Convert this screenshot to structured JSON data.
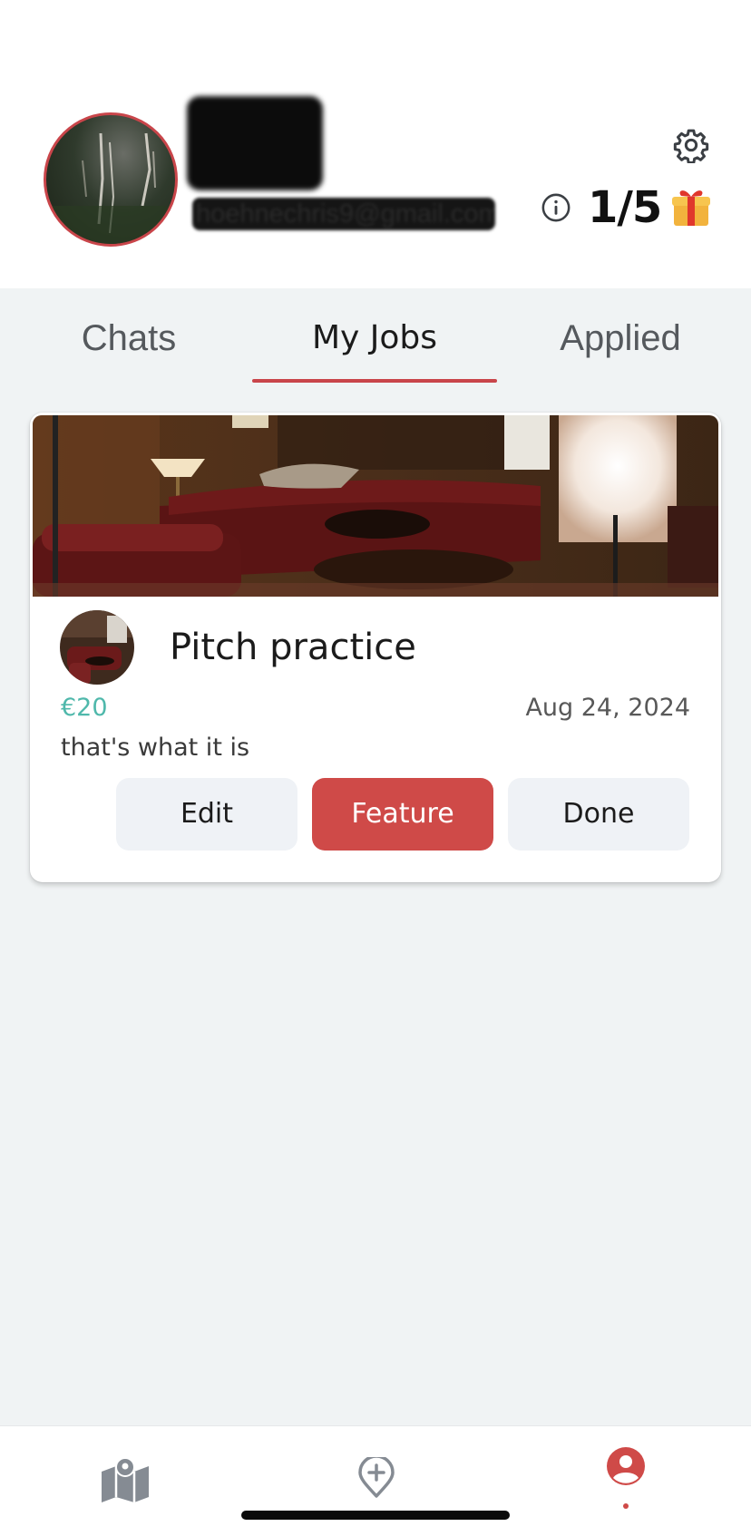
{
  "profile": {
    "email": "hoehnechris9@gmail.com",
    "credits": "1/5"
  },
  "tabs": {
    "chats": "Chats",
    "my_jobs": "My Jobs",
    "applied": "Applied",
    "active": "My Jobs"
  },
  "job": {
    "title": "Pitch practice",
    "price": "€20",
    "date": "Aug 24, 2024",
    "description": "that's what it is",
    "buttons": {
      "edit": "Edit",
      "feature": "Feature",
      "done": "Done"
    }
  },
  "nav": {
    "items": [
      "map-icon",
      "add-location-icon",
      "profile-icon"
    ],
    "active": "profile-icon"
  },
  "colors": {
    "accent": "#cf4a48",
    "price": "#4fb8ab",
    "background": "#f0f3f4"
  }
}
